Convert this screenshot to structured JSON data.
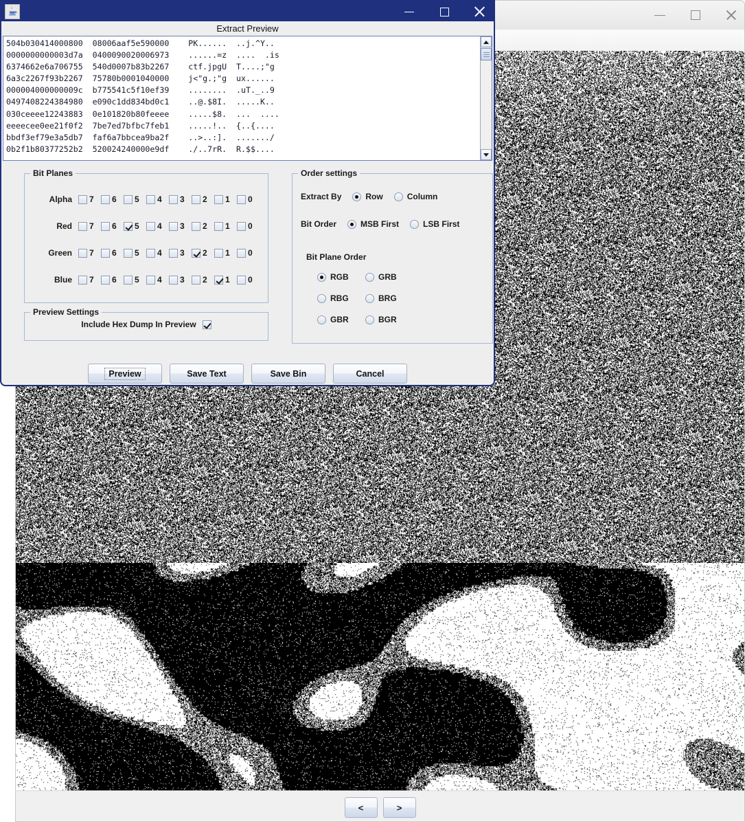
{
  "background_window": {
    "title": "",
    "controls": [
      {
        "name": "minimize",
        "glyph": "minimize-icon"
      },
      {
        "name": "maximize",
        "glyph": "maximize-icon"
      },
      {
        "name": "close",
        "glyph": "close-icon"
      }
    ],
    "nav": {
      "prev_label": "<",
      "next_label": ">"
    }
  },
  "dialog": {
    "window_icon": "java-coffee-cup-icon",
    "heading": "Extract Preview",
    "controls": [
      {
        "name": "minimize",
        "glyph": "minimize-icon"
      },
      {
        "name": "maximize",
        "glyph": "maximize-icon"
      },
      {
        "name": "close",
        "glyph": "close-icon"
      }
    ],
    "hex_dump": "504b030414000800  08006aaf5e590000    PK......  ..j.^Y..\n0000000000003d7a  0400090020006973    ......=z  ....  .is\n6374662e6a706755  540d0007b83b2267    ctf.jpgU  T....;\"g\n6a3c2267f93b2267  75780b0001040000    j<\"g.;\"g  ux......\n000004000000009c  b775541c5f10ef39    ........  .uT._..9\n0497408224384980  e090c1dd834bd0c1    ..@.$8I.  .....K..\n030ceeee12243883  0e101820b80feeee    .....$8.  ...  ....\neeeecee0ee21f0f2  7be7ed7bfbc7feb1    .....!..  {..{....\nbbdf3ef79e3a5db7  faf6a7bbcea9ba2f    ..>..:].  ......./\n0b2f1b80377252b2  520024240000e9df    ./..7rR.  R.$$....",
    "bit_planes": {
      "legend": "Bit Planes",
      "bits": [
        "7",
        "6",
        "5",
        "4",
        "3",
        "2",
        "1",
        "0"
      ],
      "channels": [
        {
          "label": "Alpha",
          "checked": [
            false,
            false,
            false,
            false,
            false,
            false,
            false,
            false
          ]
        },
        {
          "label": "Red",
          "checked": [
            false,
            false,
            true,
            false,
            false,
            false,
            false,
            false
          ]
        },
        {
          "label": "Green",
          "checked": [
            false,
            false,
            false,
            false,
            false,
            true,
            false,
            false
          ]
        },
        {
          "label": "Blue",
          "checked": [
            false,
            false,
            false,
            false,
            false,
            false,
            true,
            false
          ]
        }
      ]
    },
    "order_settings": {
      "legend": "Order settings",
      "extract_by": {
        "label": "Extract By",
        "options": [
          "Row",
          "Column"
        ],
        "selected": "Row"
      },
      "bit_order": {
        "label": "Bit Order",
        "options": [
          "MSB First",
          "LSB First"
        ],
        "selected": "MSB First"
      },
      "bit_plane_order": {
        "label": "Bit Plane Order",
        "options": [
          "RGB",
          "GRB",
          "RBG",
          "BRG",
          "GBR",
          "BGR"
        ],
        "selected": "RGB"
      }
    },
    "preview_settings": {
      "legend": "Preview Settings",
      "include_hex_dump": {
        "label": "Include Hex Dump In Preview",
        "checked": true
      }
    },
    "buttons": [
      {
        "label": "Preview",
        "focused": true
      },
      {
        "label": "Save Text",
        "focused": false
      },
      {
        "label": "Save Bin",
        "focused": false
      },
      {
        "label": "Cancel",
        "focused": false
      }
    ]
  },
  "colors": {
    "dialog_titlebar": "#1f307e",
    "dialog_face": "#eeeeee",
    "groupbox_border": "#a6b8d4",
    "button_accent": "#ccd8ea"
  }
}
